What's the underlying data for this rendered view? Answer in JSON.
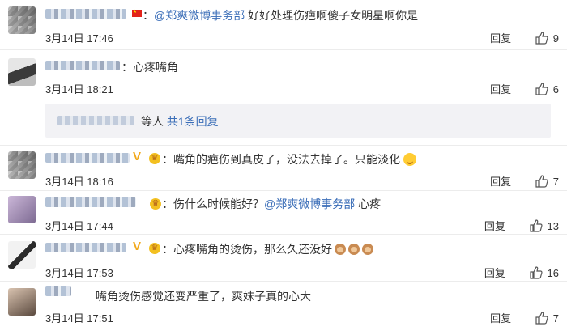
{
  "comments": [
    {
      "text_prefix": "：",
      "mention": "@郑爽微博事务部",
      "text": " 好好处理伤疤啊傻子女明星啊你是",
      "time": "3月14日 17:46",
      "reply": "回复",
      "likes": "9"
    },
    {
      "text_prefix": "：",
      "text": "心疼嘴角",
      "time": "3月14日 18:21",
      "reply": "回复",
      "likes": "6",
      "subreply": {
        "suffix": "等人",
        "link": "共1条回复"
      }
    },
    {
      "text_prefix": "：",
      "text": "嘴角的疤伤到真皮了，没法去掉了。只能淡化",
      "time": "3月14日 18:16",
      "reply": "回复",
      "likes": "7"
    },
    {
      "text_prefix": "：",
      "text": "伤什么时候能好？",
      "mention": "@郑爽微博事务部",
      "text2": " 心疼",
      "time": "3月14日 17:44",
      "reply": "回复",
      "likes": "13"
    },
    {
      "text_prefix": "：",
      "text": "心疼嘴角的烫伤，那么久还没好",
      "time": "3月14日 17:53",
      "reply": "回复",
      "likes": "16"
    },
    {
      "text_prefix": "：",
      "text": "嘴角烫伤感觉还变严重了，爽妹子真的心大",
      "time": "3月14日 17:51",
      "reply": "回复",
      "likes": "7"
    }
  ],
  "icons": {
    "like": "thumbs-up-icon",
    "vip": "v-badge-icon",
    "level": "level-badge-icon"
  },
  "colors": {
    "link": "#3b6eb8",
    "divider": "#ececec",
    "subreply_bg": "#f2f2f5"
  }
}
